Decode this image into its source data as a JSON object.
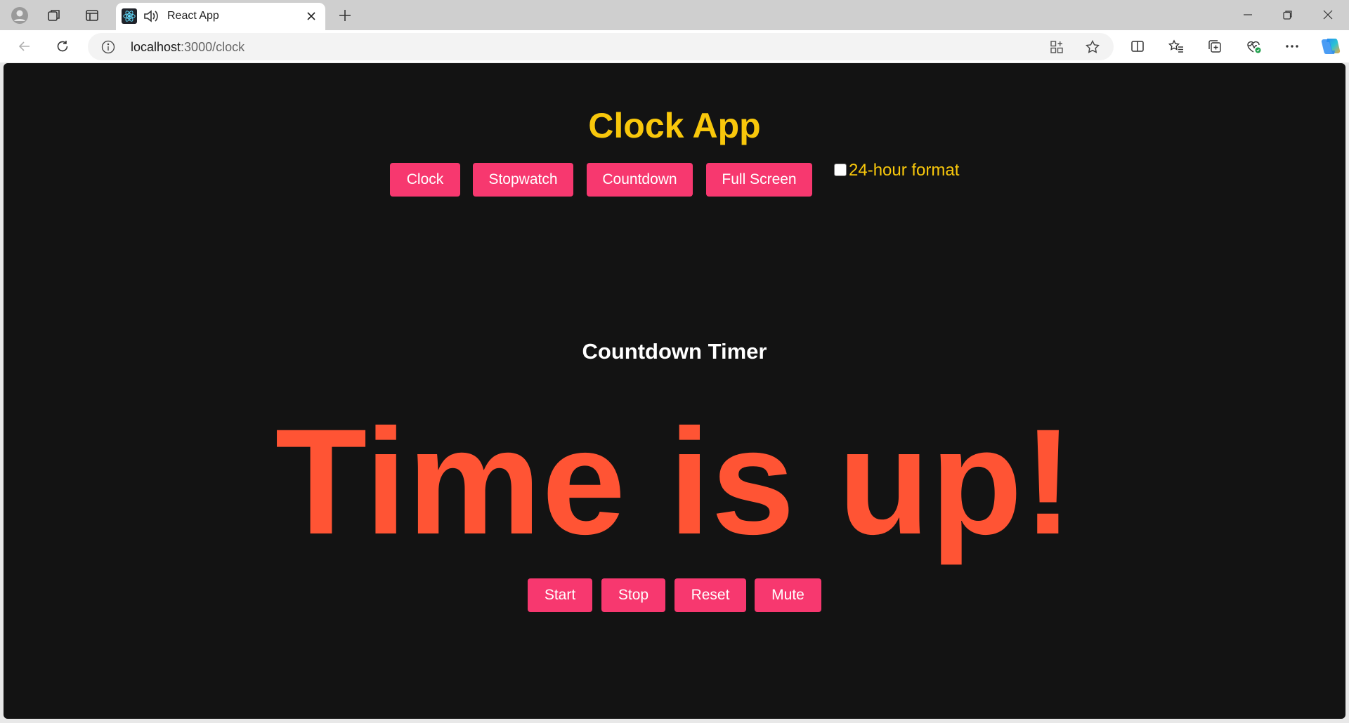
{
  "browser": {
    "tab": {
      "title": "React App"
    },
    "address": {
      "host": "localhost",
      "path": ":3000/clock"
    }
  },
  "app": {
    "title": "Clock App",
    "nav_buttons": [
      "Clock",
      "Stopwatch",
      "Countdown",
      "Full Screen"
    ],
    "format_toggle": {
      "label": "24-hour format",
      "checked": false
    },
    "section_title": "Countdown Timer",
    "message": "Time is up!",
    "control_buttons": [
      "Start",
      "Stop",
      "Reset",
      "Mute"
    ]
  },
  "colors": {
    "background": "#131313",
    "title": "#f8c70b",
    "button": "#f7386f",
    "message": "#ff5434"
  },
  "icons": [
    "profile-icon",
    "workspaces-icon",
    "tab-actions-icon",
    "react-favicon",
    "audio-playing-icon",
    "close-icon",
    "new-tab-icon",
    "minimize-icon",
    "restore-icon",
    "window-close-icon",
    "back-icon",
    "refresh-icon",
    "site-info-icon",
    "app-available-icon",
    "favorite-star-icon",
    "split-screen-icon",
    "favorites-icon",
    "collections-icon",
    "browser-essentials-icon",
    "more-icon",
    "copilot-icon"
  ]
}
